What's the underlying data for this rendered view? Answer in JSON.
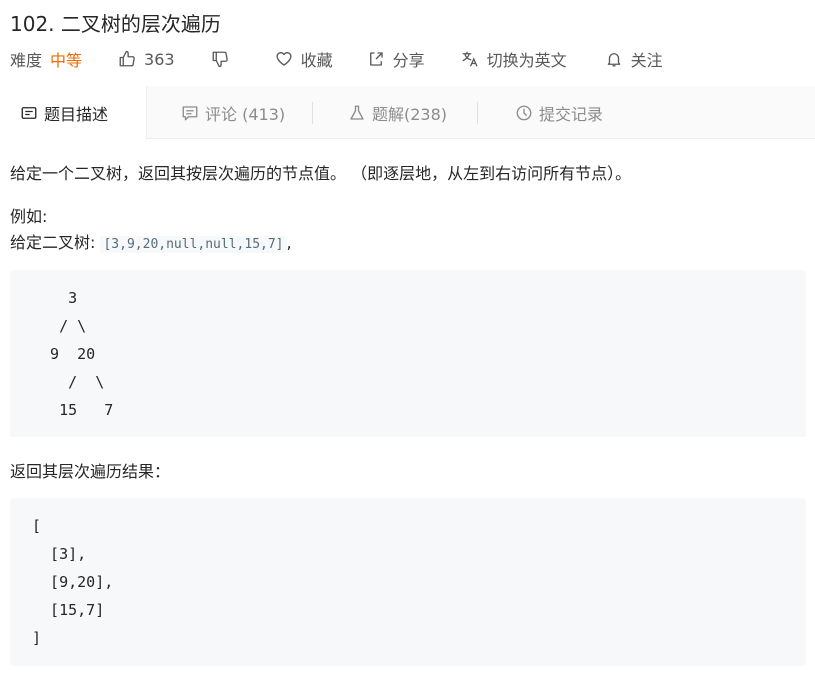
{
  "problem": {
    "title": "102. 二叉树的层次遍历",
    "difficulty_label": "难度",
    "difficulty": "中等",
    "likes": "363",
    "favorite_label": "收藏",
    "share_label": "分享",
    "switch_lang_label": "切换为英文",
    "follow_label": "关注"
  },
  "tabs": [
    {
      "label": "题目描述",
      "icon": "description-icon",
      "active": true
    },
    {
      "label": "评论 (413)",
      "icon": "comment-icon",
      "active": false
    },
    {
      "label": "题解(238)",
      "icon": "flask-icon",
      "active": false
    },
    {
      "label": "提交记录",
      "icon": "clock-icon",
      "active": false
    }
  ],
  "content": {
    "intro": "给定一个二叉树，返回其按层次遍历的节点值。 （即逐层地，从左到右访问所有节点）。",
    "example_label": "例如:",
    "given_label": "给定二叉树: ",
    "given_value": "[3,9,20,null,null,15,7]",
    "given_suffix": ",",
    "tree_lines": [
      "    3",
      "   / \\",
      "  9  20",
      "    /  \\",
      "   15   7"
    ],
    "result_label": "返回其层次遍历结果：",
    "result_lines": [
      "[",
      "  [3],",
      "  [9,20],",
      "  [15,7]",
      "]"
    ]
  },
  "colors": {
    "difficulty_medium": "#ef6c00",
    "code_bg": "#f7f8fa",
    "tab_bar_bg": "#fafafa"
  }
}
